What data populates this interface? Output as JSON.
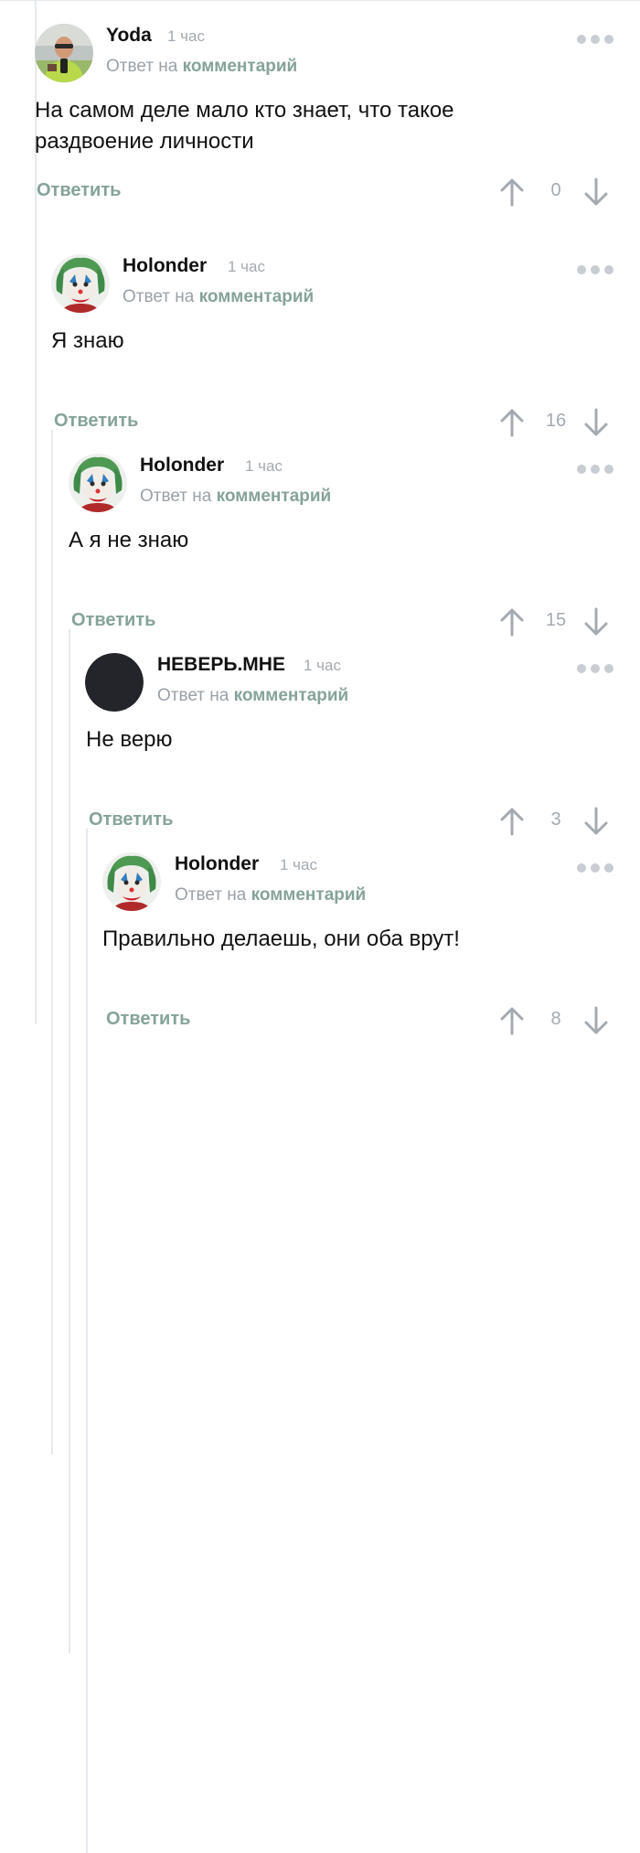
{
  "reply_prefix": "Ответ на",
  "reply_link": "комментарий",
  "reply_button": "Ответить",
  "comments": [
    {
      "author": "Yoda",
      "time": "1 час",
      "text": "На самом деле мало кто знает, что такое раздвоение личности",
      "score": "0",
      "avatar": "photo-avatar"
    },
    {
      "author": "Holonder",
      "time": "1 час",
      "text": "Я знаю",
      "score": "16",
      "avatar": "joker-avatar"
    },
    {
      "author": "Holonder",
      "time": "1 час",
      "text": "А я не знаю",
      "score": "15",
      "avatar": "joker-avatar"
    },
    {
      "author": "НЕВЕРЬ.МНЕ",
      "time": "1 час",
      "text": "Не верю",
      "score": "3",
      "avatar": "dark-circle-avatar"
    },
    {
      "author": "Holonder",
      "time": "1 час",
      "text": "Правильно делаешь, они оба врут!",
      "score": "8",
      "avatar": "joker-avatar"
    }
  ],
  "colors": {
    "accent": "#85a39a",
    "muted": "#a4aab0",
    "thread_line": "#e6e9ec",
    "dots": "#c7cdd2"
  }
}
